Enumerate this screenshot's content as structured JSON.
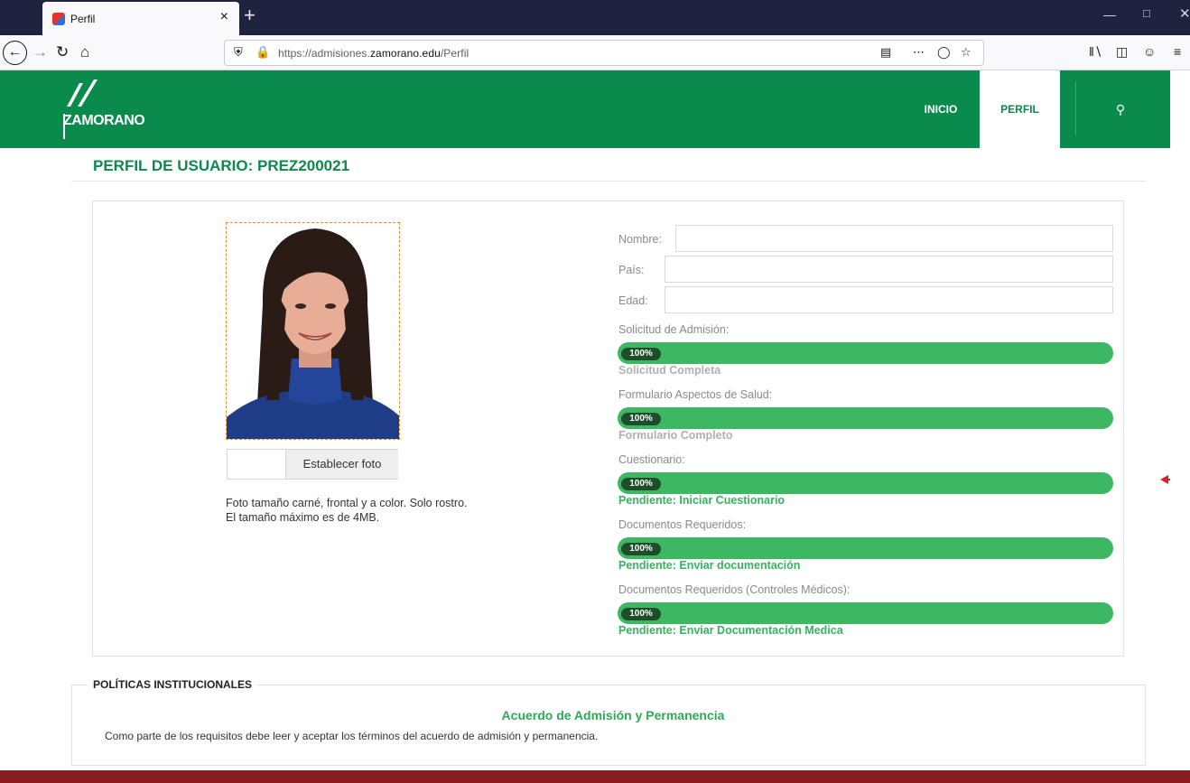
{
  "browser": {
    "tab_title": "Perfil",
    "tab_close": "×",
    "new_tab": "+",
    "url_prefix": "https://admisiones.",
    "url_domain": "zamorano.edu",
    "url_path": "/Perfil"
  },
  "header": {
    "logo_text": "ZAMORANO",
    "nav": {
      "inicio": "INICIO",
      "perfil": "PERFIL"
    }
  },
  "page": {
    "title": "PERFIL DE USUARIO: PREZ200021"
  },
  "photo": {
    "upload_label": "Establecer foto",
    "note_line1": "Foto tamaño carné, frontal y a color. Solo rostro.",
    "note_line2": "El tamaño máximo es de 4MB."
  },
  "profile": {
    "nombre_label": "Nombre:",
    "nombre_value": "",
    "pais_label": "País:",
    "pais_value": "",
    "edad_label": "Edad:",
    "edad_value": ""
  },
  "progress": [
    {
      "label": "Solicitud de Admisión:",
      "percent": "100%",
      "status": "Solicitud Completa",
      "state": "complete"
    },
    {
      "label": "Formulario Aspectos de Salud:",
      "percent": "100%",
      "status": "Formulario Completo",
      "state": "complete"
    },
    {
      "label": "Cuestionario:",
      "percent": "100%",
      "status": "Pendiente: Iniciar Cuestionario",
      "state": "pending"
    },
    {
      "label": "Documentos Requeridos:",
      "percent": "100%",
      "status": "Pendiente: Enviar documentación",
      "state": "pending"
    },
    {
      "label": "Documentos Requeridos (Controles Médicos):",
      "percent": "100%",
      "status": "Pendiente: Enviar Documentación Medica",
      "state": "pending"
    }
  ],
  "policies": {
    "legend": "POLÍTICAS INSTITUCIONALES",
    "title": "Acuerdo de Admisión y Permanencia",
    "text": "Como parte de los requisitos debe leer y aceptar los términos del acuerdo de admisión y permanencia."
  },
  "colors": {
    "brand_green": "#0a8a4c",
    "progress_green": "#3cb862",
    "pill_dark": "#1e4d2b",
    "footer_red": "#8a1b1e"
  }
}
